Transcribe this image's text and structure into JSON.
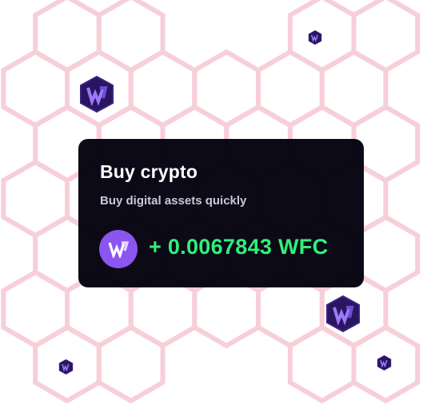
{
  "card": {
    "title": "Buy crypto",
    "subtitle": "Buy digital assets quickly",
    "token_icon": "wfc-logo-icon",
    "amount": "+ 0.0067843 WFC"
  },
  "colors": {
    "hex_stroke": "#f7cfd8",
    "card_background": "#040210",
    "amount_green": "#2ff07a",
    "token_badge_purple": "#8b56f0",
    "coin_dark": "#2a1660"
  },
  "decor": {
    "hex_icon": "hexagon-grid-pattern",
    "coin_icon": "wfc-hex-coin-icon"
  }
}
